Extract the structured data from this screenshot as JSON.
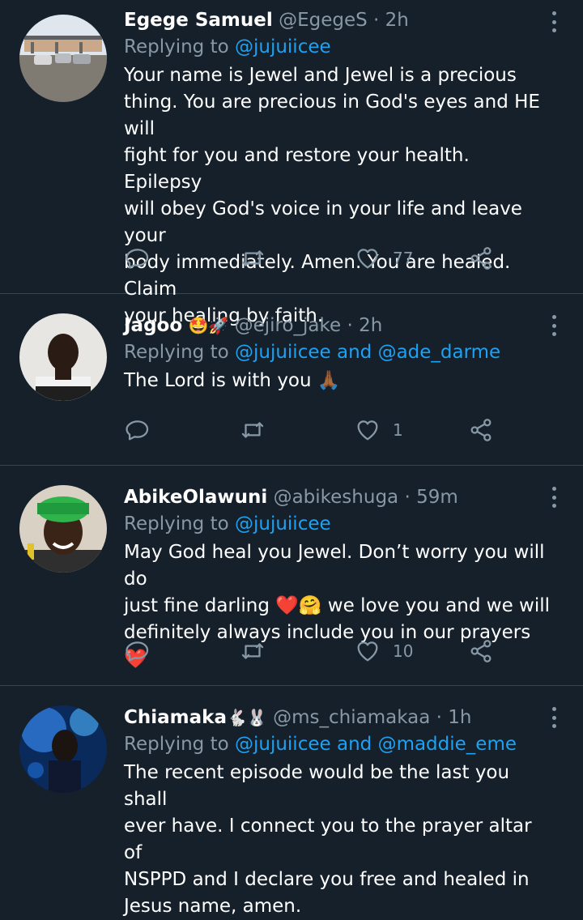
{
  "tweets": [
    {
      "name": "Egege Samuel",
      "handle": "@EgegeS",
      "time": "2h",
      "replying_label": "Replying to",
      "mentions": [
        "@jujuiicee"
      ],
      "and_label": "",
      "lines": [
        "Your name is Jewel and Jewel is a precious",
        "thing. You are precious in God's eyes and HE will",
        "fight for you and restore your health. Epilepsy",
        "will obey God's voice in your life and leave your",
        "body immediately. Amen. You are healed. Claim",
        "your healing by faith."
      ],
      "likes": "77"
    },
    {
      "name": "Jagoo",
      "name_emoji": "🤩🚀",
      "handle": "@ejiro_jake",
      "time": "2h",
      "replying_label": "Replying to",
      "mentions": [
        "@jujuiicee",
        "@ade_darme"
      ],
      "and_label": "and",
      "lines": [
        "The Lord is with you 🙏🏾"
      ],
      "likes": "1"
    },
    {
      "name": "AbikeOlawuni",
      "handle": "@abikeshuga",
      "time": "59m",
      "replying_label": "Replying to",
      "mentions": [
        "@jujuiicee"
      ],
      "and_label": "",
      "lines": [
        "May God heal you Jewel. Don’t worry you will do",
        "just fine darling ❤️🤗 we love you and we will",
        "definitely always include you in our prayers❤️"
      ],
      "likes": "10"
    },
    {
      "name": "Chiamaka",
      "name_emoji": "🐇🐰",
      "handle": "@ms_chiamakaa",
      "time": "1h",
      "replying_label": "Replying to",
      "mentions": [
        "@jujuiicee",
        "@maddie_eme"
      ],
      "and_label": "and",
      "lines": [
        "The recent episode would be the last you shall",
        "ever have. I connect you to the prayer altar of",
        "NSPPD and I declare you free and healed in",
        "Jesus name, amen."
      ],
      "likes": ""
    }
  ],
  "separator": "·",
  "icons": {
    "reply": "reply-icon",
    "retweet": "retweet-icon",
    "like": "heart-icon",
    "share": "share-icon",
    "more": "more-vertical-icon"
  },
  "colors": {
    "background": "#15202b",
    "secondary_text": "#8899a6",
    "link": "#1da1f2",
    "divider": "#38444d"
  }
}
